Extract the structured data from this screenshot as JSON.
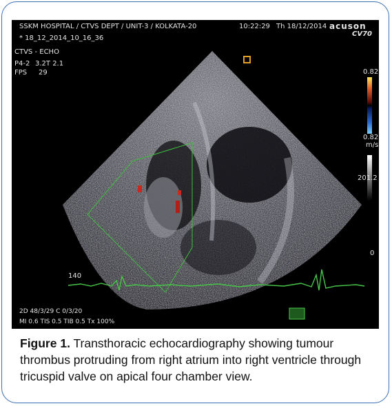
{
  "overlay": {
    "header": "SSKM HOSPITAL / CTVS DEPT / UNIT-3 / KOLKATA-20",
    "time": "10:22:29",
    "date": "Th 18/12/2014",
    "logo": "acuson",
    "model": "CV70",
    "study_id": "* 18_12_2014_10_16_36",
    "exam": "CTVS - ECHO",
    "probe_label": "P4-2",
    "probe_value": "3.2T 2.1",
    "fps_label": "FPS",
    "fps_value": "29",
    "scale_top": "0.82",
    "scale_bottom": "0.82",
    "scale_unit": "m/s",
    "gray_value": "201.2",
    "depth_marker": "0",
    "hr_value": "140",
    "params_line1": "2D 48/3/29   C 0/3/20",
    "params_line2": "MI 0.6    TIS 0.5    TIB 0.5    Tx    100%"
  },
  "caption": {
    "label": "Figure 1.",
    "text": " Transthoracic echocardiography showing tumour thrombus protruding from right atrium into right ventricle through tricuspid valve on apical four chamber view."
  },
  "colors": {
    "frame_border": "#3b6fb3",
    "roi_box": "#3fbf3f",
    "ecg_trace": "#48c848",
    "doppler_red": "#c8281e",
    "doppler_blue": "#3c78dc"
  }
}
